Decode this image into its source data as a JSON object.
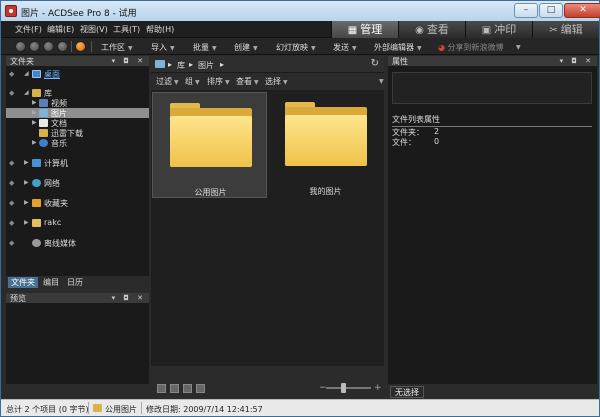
{
  "window": {
    "title": "图片 - ACDSee Pro 8 - 试用",
    "controls": {
      "minimize": "–",
      "maximize": "□",
      "close": "✕"
    }
  },
  "menu": {
    "items": [
      "文件(F)",
      "编辑(E)",
      "视图(V)",
      "工具(T)",
      "帮助(H)"
    ],
    "modes": [
      {
        "label": "管理",
        "icon": "grid-icon"
      },
      {
        "label": "查看",
        "icon": "eye-icon"
      },
      {
        "label": "冲印",
        "icon": "photo-icon"
      },
      {
        "label": "编辑",
        "icon": "tools-icon"
      }
    ]
  },
  "toolbar": {
    "workspace": "工作区",
    "import": "导入",
    "batch": "批量",
    "create": "创建",
    "slideshow": "幻灯放映",
    "send": "发送",
    "external_editor": "外部编辑器",
    "share": "分享到新浪微博"
  },
  "folders_panel": {
    "title": "文件夹",
    "desktop": "桌面",
    "library": "库",
    "video": "视频",
    "pictures": "图片",
    "docs": "文档",
    "download": "迅雷下载",
    "music": "音乐",
    "computer": "计算机",
    "network": "网络",
    "favorites": "收藏夹",
    "user": "rakc",
    "offline": "离线媒体"
  },
  "panel_tabs": [
    "文件夹",
    "编目",
    "日历"
  ],
  "preview_panel": {
    "title": "预览"
  },
  "breadcrumb": {
    "library": "库",
    "pictures": "图片"
  },
  "filterbar": {
    "filter": "过滤",
    "group": "组",
    "sort": "排序",
    "view": "查看",
    "select": "选择"
  },
  "grid": {
    "items": [
      {
        "caption": "公用图片"
      },
      {
        "caption": "我的图片"
      }
    ]
  },
  "properties": {
    "title": "属性",
    "section": "文件列表属性",
    "folders_label": "文件夹：",
    "folders_value": "2",
    "files_label": "文件：",
    "files_value": "0",
    "no_selection": "无选择"
  },
  "statusbar": {
    "total": "总计 2 个项目 (0 字节)",
    "current": "公用图片",
    "modified": "修改日期: 2009/7/14 12:41:57"
  }
}
